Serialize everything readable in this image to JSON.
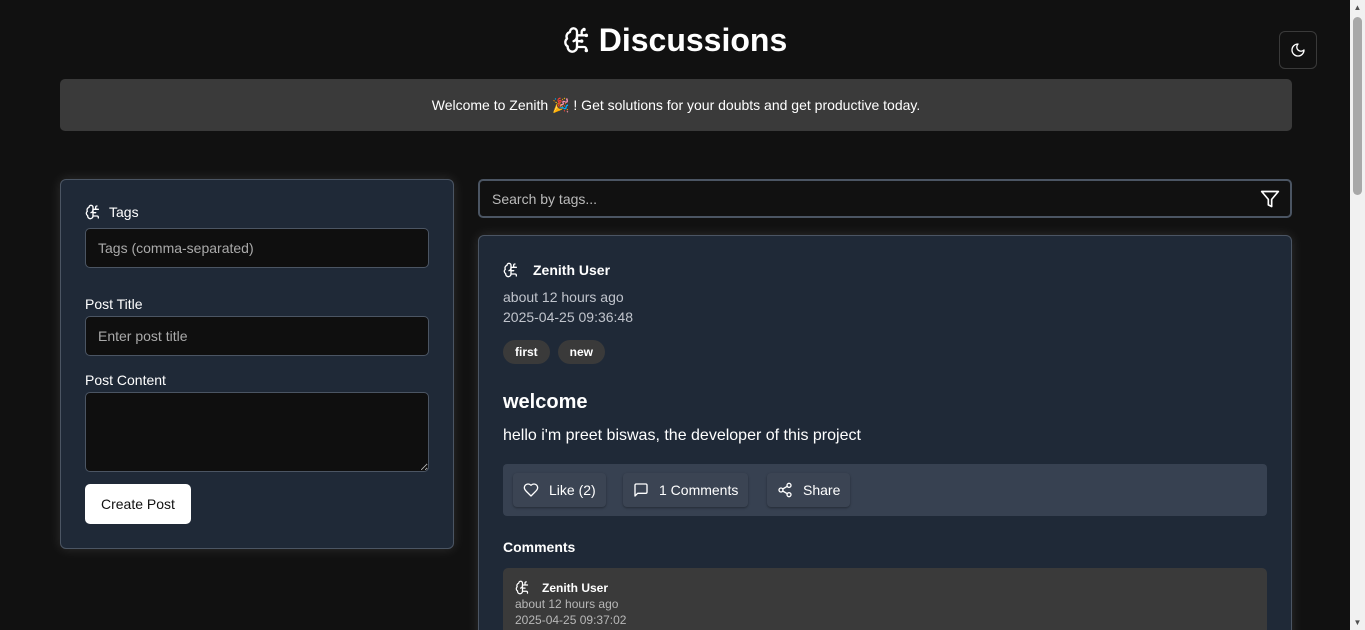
{
  "header": {
    "title": "Discussions",
    "theme_toggle_icon": "moon-icon"
  },
  "banner": {
    "text": "Welcome to Zenith 🎉 ! Get solutions for your doubts and get productive today."
  },
  "form": {
    "tags_label": "Tags",
    "tags_placeholder": "Tags (comma-separated)",
    "title_label": "Post Title",
    "title_placeholder": "Enter post title",
    "content_label": "Post Content",
    "create_button": "Create Post"
  },
  "search": {
    "placeholder": "Search by tags...",
    "filter_icon": "filter-icon"
  },
  "post": {
    "author": "Zenith User",
    "relative_time": "about 12 hours ago",
    "timestamp": "2025-04-25 09:36:48",
    "tags": [
      "first",
      "new"
    ],
    "title": "welcome",
    "body": "hello i'm preet biswas, the developer of this project",
    "actions": {
      "like": "Like (2)",
      "comments": "1 Comments",
      "share": "Share"
    },
    "comments_heading": "Comments",
    "comments": [
      {
        "author": "Zenith User",
        "relative_time": "about 12 hours ago",
        "timestamp": "2025-04-25 09:37:02"
      }
    ]
  },
  "colors": {
    "background": "#111111",
    "card": "#1f2937",
    "banner": "#3a3a3a",
    "actions_bar": "#374151"
  }
}
